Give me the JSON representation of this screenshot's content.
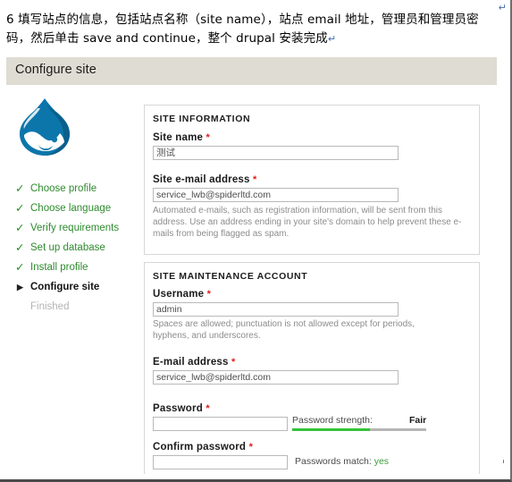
{
  "annotation": {
    "text": "6 填写站点的信息，包括站点名称（site name），站点 email 地址，管理员和管理员密码，然后单击 save and continue，整个 drupal 安装完成",
    "pilcrow": "↵",
    "return_mark_top": "↵",
    "return_mark_bottom": "↵"
  },
  "header": {
    "title": "Configure site"
  },
  "sidebar": {
    "logo_alt": "drupal-droplet-logo",
    "steps": [
      {
        "label": "Choose profile",
        "state": "done",
        "mark": "✓"
      },
      {
        "label": "Choose language",
        "state": "done",
        "mark": "✓"
      },
      {
        "label": "Verify requirements",
        "state": "done",
        "mark": "✓"
      },
      {
        "label": "Set up database",
        "state": "done",
        "mark": "✓"
      },
      {
        "label": "Install profile",
        "state": "done",
        "mark": "✓"
      },
      {
        "label": "Configure site",
        "state": "active",
        "mark": "▶"
      },
      {
        "label": "Finished",
        "state": "pending",
        "mark": ""
      }
    ]
  },
  "site_information": {
    "legend": "SITE INFORMATION",
    "site_name": {
      "label": "Site name",
      "required_mark": "*",
      "value": "测试"
    },
    "site_email": {
      "label": "Site e-mail address",
      "required_mark": "*",
      "value": "service_lwb@spiderltd.com",
      "help": "Automated e-mails, such as registration information, will be sent from this address. Use an address ending in your site's domain to help prevent these e-mails from being flagged as spam."
    }
  },
  "site_maintenance_account": {
    "legend": "SITE MAINTENANCE ACCOUNT",
    "username": {
      "label": "Username",
      "required_mark": "*",
      "value": "admin",
      "help": "Spaces are allowed; punctuation is not allowed except for periods, hyphens, and underscores."
    },
    "email": {
      "label": "E-mail address",
      "required_mark": "*",
      "value": "service_lwb@spiderltd.com"
    },
    "password": {
      "label": "Password",
      "required_mark": "*",
      "value": "",
      "strength_label": "Password strength:",
      "strength_value": "Fair",
      "strength_percent": 58
    },
    "confirm_password": {
      "label": "Confirm password",
      "required_mark": "*",
      "value": "",
      "match_label": "Passwords match:",
      "match_value": "yes"
    }
  },
  "colors": {
    "header_bar": "#dedcd3",
    "step_done": "#2e8b2e",
    "step_pending": "#b4b4b4",
    "required": "#e01b1b",
    "strength_bar": "#35c23a",
    "drupal_blue": "#0c76ab"
  }
}
